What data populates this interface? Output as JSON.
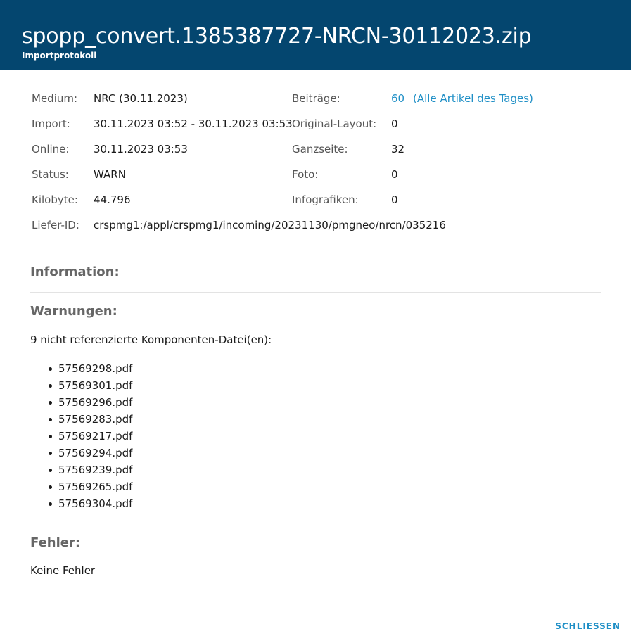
{
  "header": {
    "title": "spopp_convert.1385387727-NRCN-30112023.zip",
    "subtitle": "Importprotokoll"
  },
  "meta_left": [
    {
      "label": "Medium:",
      "value": "NRC (30.11.2023)"
    },
    {
      "label": "Import:",
      "value": "30.11.2023 03:52 - 30.11.2023 03:53"
    },
    {
      "label": "Online:",
      "value": "30.11.2023 03:53"
    },
    {
      "label": "Status:",
      "value": "WARN"
    },
    {
      "label": "Kilobyte:",
      "value": "44.796"
    },
    {
      "label": "Liefer-ID:",
      "value": "crspmg1:/appl/crspmg1/incoming/20231130/pmgneo/nrcn/035216"
    }
  ],
  "meta_right": [
    {
      "label": "Beiträge:",
      "value": "60",
      "extra_link": "(Alle Artikel des Tages)"
    },
    {
      "label": "Original-Layout:",
      "value": "0"
    },
    {
      "label": "Ganzseite:",
      "value": "32"
    },
    {
      "label": "Foto:",
      "value": "0"
    },
    {
      "label": "Infografiken:",
      "value": "0"
    }
  ],
  "sections": {
    "information": {
      "title": "Information:"
    },
    "warnings": {
      "title": "Warnungen:",
      "intro": "9 nicht referenzierte Komponenten-Datei(en):",
      "files": [
        "57569298.pdf",
        "57569301.pdf",
        "57569296.pdf",
        "57569283.pdf",
        "57569217.pdf",
        "57569294.pdf",
        "57569239.pdf",
        "57569265.pdf",
        "57569304.pdf"
      ]
    },
    "errors": {
      "title": "Fehler:",
      "text": "Keine Fehler"
    }
  },
  "footer": {
    "close_label": "SCHLIESSEN"
  },
  "colors": {
    "header_bg": "#04466f",
    "link": "#1f8fc6"
  }
}
